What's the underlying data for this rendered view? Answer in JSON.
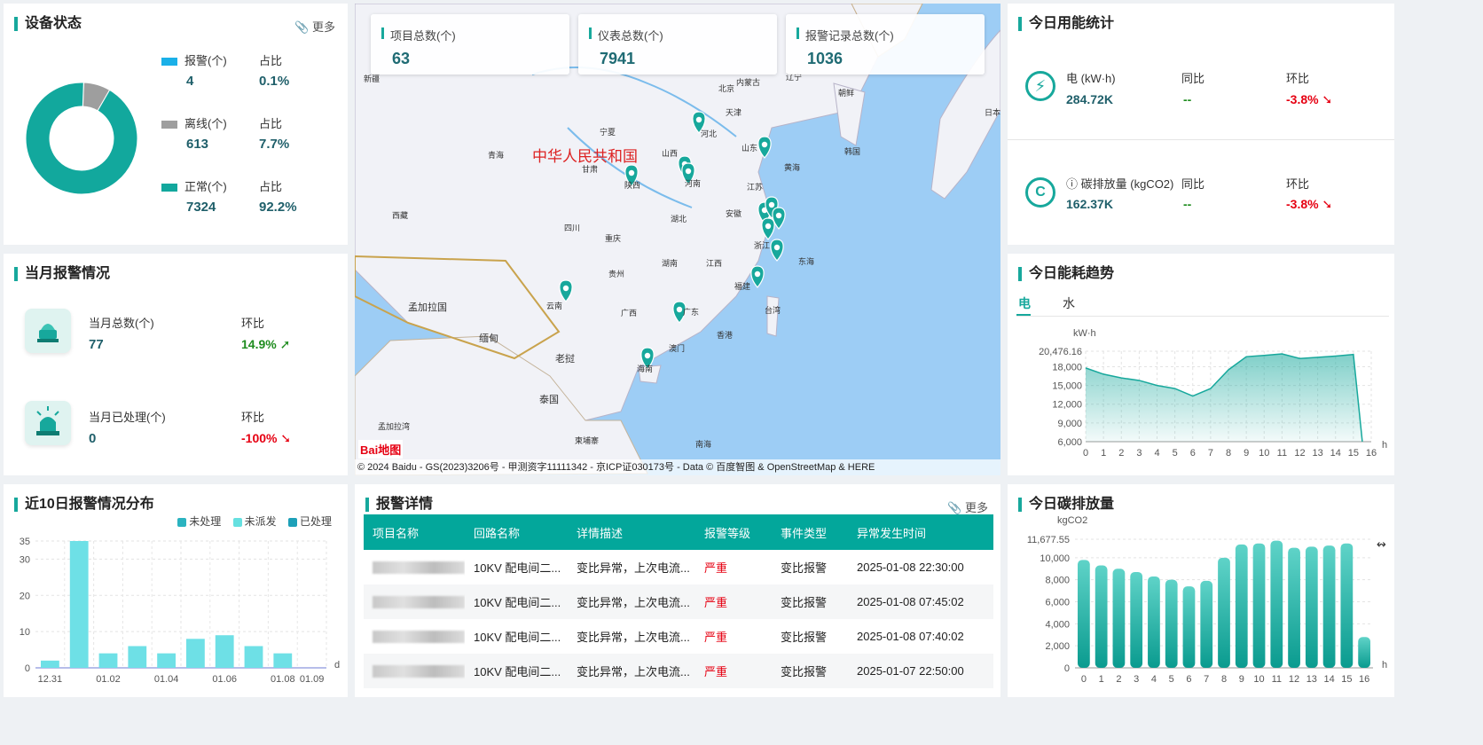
{
  "device_status": {
    "title": "设备状态",
    "more": "更多",
    "items": [
      {
        "label": "报警(个)",
        "value": "4",
        "ratio_label": "占比",
        "ratio": "0.1%",
        "color": "#1ab0e8"
      },
      {
        "label": "离线(个)",
        "value": "613",
        "ratio_label": "占比",
        "ratio": "7.7%",
        "color": "#9e9e9e"
      },
      {
        "label": "正常(个)",
        "value": "7324",
        "ratio_label": "占比",
        "ratio": "92.2%",
        "color": "#12a89d"
      }
    ]
  },
  "monthly_alarm": {
    "title": "当月报警情况",
    "total_label": "当月总数(个)",
    "total": "77",
    "total_ring_label": "环比",
    "total_ring": "14.9%",
    "handled_label": "当月已处理(个)",
    "handled": "0",
    "handled_ring_label": "环比",
    "handled_ring": "-100%"
  },
  "map": {
    "cards": [
      {
        "label": "项目总数(个)",
        "value": "63"
      },
      {
        "label": "仪表总数(个)",
        "value": "7941"
      },
      {
        "label": "报警记录总数(个)",
        "value": "1036"
      }
    ],
    "country_label": "中华人民共和国",
    "places": [
      "新疆",
      "青海",
      "西藏",
      "甘肃",
      "宁夏",
      "陕西",
      "山西",
      "河北",
      "北京",
      "天津",
      "辽宁",
      "朝鲜",
      "韩国",
      "日本",
      "山东",
      "河南",
      "江苏",
      "安徽",
      "湖北",
      "四川",
      "重庆",
      "贵州",
      "湖南",
      "江西",
      "浙江",
      "福建",
      "云南",
      "广西",
      "广东",
      "台湾",
      "香港",
      "澳门",
      "海南",
      "孟加拉国",
      "缅甸",
      "老挝",
      "泰国",
      "柬埔寨",
      "黄海",
      "东海",
      "南海",
      "内蒙古",
      "孟加拉湾"
    ],
    "logo": "Bai地图",
    "copyright": "© 2024 Baidu - GS(2023)3206号 - 甲测资字11111342 - 京ICP证030173号 - Data © 百度智图 & OpenStreetMap & HERE"
  },
  "energy_stats": {
    "title": "今日用能统计",
    "rows": [
      {
        "label": "电 (kW·h)",
        "value": "284.72K",
        "yoy_label": "同比",
        "yoy": "--",
        "mom_label": "环比",
        "mom": "-3.8%"
      },
      {
        "label": "碳排放量 (kgCO2)",
        "value": "162.37K",
        "yoy_label": "同比",
        "yoy": "--",
        "mom_label": "环比",
        "mom": "-3.8%"
      }
    ]
  },
  "energy_trend": {
    "title": "今日能耗趋势",
    "tabs": [
      "电",
      "水"
    ],
    "unit": "kW·h",
    "xunit": "h"
  },
  "alarm_10d": {
    "title": "近10日报警情况分布",
    "legend": [
      "未处理",
      "未派发",
      "已处理"
    ],
    "xunit": "d"
  },
  "alarm_detail": {
    "title": "报警详情",
    "more": "更多",
    "columns": [
      "项目名称",
      "回路名称",
      "详情描述",
      "报警等级",
      "事件类型",
      "异常发生时间"
    ],
    "rows": [
      {
        "circuit": "10KV 配电间二...",
        "desc": "变比异常，上次电流...",
        "level": "严重",
        "type": "变比报警",
        "time": "2025-01-08 22:30:00"
      },
      {
        "circuit": "10KV 配电间二...",
        "desc": "变比异常，上次电流...",
        "level": "严重",
        "type": "变比报警",
        "time": "2025-01-08 07:45:02"
      },
      {
        "circuit": "10KV 配电间二...",
        "desc": "变比异常，上次电流...",
        "level": "严重",
        "type": "变比报警",
        "time": "2025-01-08 07:40:02"
      },
      {
        "circuit": "10KV 配电间二...",
        "desc": "变比异常，上次电流...",
        "level": "严重",
        "type": "变比报警",
        "time": "2025-01-07 22:50:00"
      }
    ]
  },
  "carbon_today": {
    "title": "今日碳排放量",
    "unit": "kgCO2",
    "xunit": "h"
  },
  "chart_data": [
    {
      "type": "pie",
      "categories": [
        "报警",
        "离线",
        "正常"
      ],
      "values": [
        4,
        613,
        7324
      ],
      "colors": [
        "#1ab0e8",
        "#9e9e9e",
        "#12a89d"
      ]
    },
    {
      "type": "area",
      "x": [
        0,
        1,
        2,
        3,
        4,
        5,
        6,
        7,
        8,
        9,
        10,
        11,
        12,
        13,
        14,
        15,
        15.5
      ],
      "values": [
        17800,
        16800,
        16200,
        15800,
        15000,
        14500,
        13300,
        14500,
        17500,
        19600,
        19800,
        20050,
        19300,
        19500,
        19700,
        19950,
        6000
      ],
      "ylabel": "kW·h",
      "yticks": [
        "6,000",
        "9,000",
        "12,000",
        "15,000",
        "18,000",
        "20,476.16"
      ],
      "ylim": [
        6000,
        20476.16
      ],
      "xticks": [
        "0",
        "1",
        "2",
        "3",
        "4",
        "5",
        "6",
        "7",
        "8",
        "9",
        "10",
        "11",
        "12",
        "13",
        "14",
        "15",
        "16"
      ]
    },
    {
      "type": "bar",
      "categories": [
        "12.31",
        "",
        "01.02",
        "",
        "01.04",
        "",
        "01.06",
        "",
        "01.08",
        "01.09"
      ],
      "values": [
        2,
        35,
        4,
        6,
        4,
        8,
        9,
        6,
        4,
        0
      ],
      "yticks": [
        "0",
        "10",
        "20",
        "30",
        "35"
      ],
      "ylim": [
        0,
        35
      ]
    },
    {
      "type": "bar",
      "categories": [
        "0",
        "1",
        "2",
        "3",
        "4",
        "5",
        "6",
        "7",
        "8",
        "9",
        "10",
        "11",
        "12",
        "13",
        "14",
        "15",
        "16"
      ],
      "values": [
        9800,
        9300,
        9000,
        8700,
        8300,
        8000,
        7400,
        7900,
        10000,
        11200,
        11300,
        11550,
        10900,
        11000,
        11100,
        11300,
        2800
      ],
      "ylabel": "kgCO2",
      "yticks": [
        "0",
        "2,000",
        "4,000",
        "6,000",
        "8,000",
        "10,000",
        "11,677.55"
      ],
      "ylim": [
        0,
        11677.55
      ]
    }
  ]
}
